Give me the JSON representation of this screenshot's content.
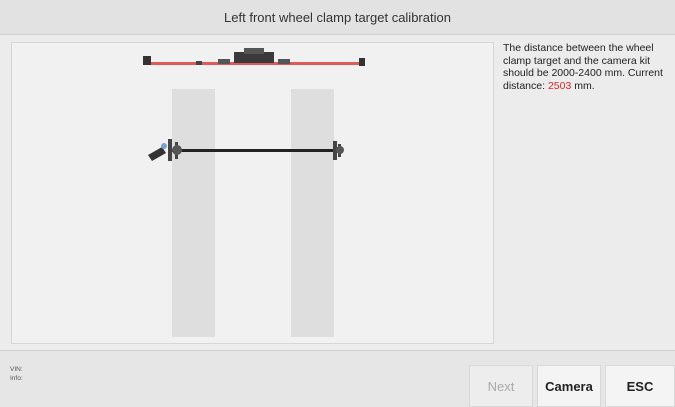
{
  "header": {
    "title": "Left front wheel clamp target calibration"
  },
  "instructions": {
    "text_before": "The distance between the wheel clamp target and the camera kit should be 2000-2400 mm. Current distance: ",
    "current_value": "2503",
    "text_after": " mm."
  },
  "footer": {
    "vin_label": "VIN:",
    "info_label": "Info:",
    "buttons": {
      "next": "Next",
      "camera": "Camera",
      "esc": "ESC"
    }
  },
  "colors": {
    "highlight": "#e0262b"
  }
}
